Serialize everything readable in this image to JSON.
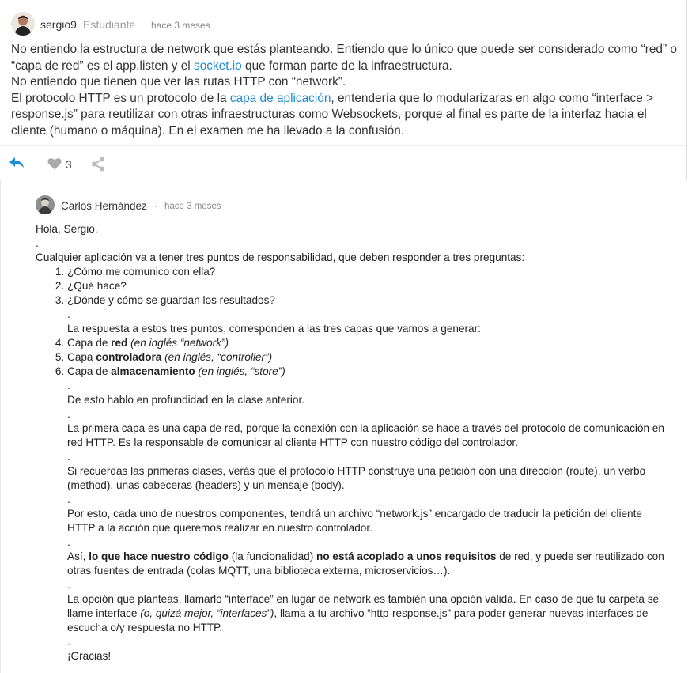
{
  "post": {
    "username": "sergio9",
    "role": "Estudiante",
    "separator": "·",
    "time": "hace 3 meses",
    "para1_a": "No entiendo la estructura de network que estás planteando. Entiendo que lo único que puede ser considerado como “red” o “capa de red” es el app.listen y el ",
    "para1_link": "socket.io",
    "para1_b": " que forman parte de la infraestructura.",
    "para2": "No entiendo que tienen que ver las rutas HTTP con “network”.",
    "para3_a": "El protocolo HTTP es un protocolo de la ",
    "para3_link": "capa de aplicación",
    "para3_b": ", entendería que lo modularizaras en algo como “interface > response.js” para reutilizar con otras infraestructuras como Websockets, porque al final es parte de la interfaz hacia el cliente (humano o máquina). En el examen me ha llevado a la confusión.",
    "likes": "3",
    "icons": {
      "reply": "reply-arrow-icon",
      "like": "heart-icon",
      "share": "share-icon"
    },
    "accent": "#1b8bd2"
  },
  "reply": {
    "username": "Carlos Hernández",
    "separator": "·",
    "time": "hace 3 meses",
    "greeting": "Hola, Sergio,",
    "dot": ".",
    "intro": "Cualquier aplicación va a tener tres puntos de responsabilidad, que deben responder a tres preguntas:",
    "questions": [
      "¿Cómo me comunico con ella?",
      "¿Qué hace?",
      "¿Dónde y cómo se guardan los resultados?"
    ],
    "answer_intro": "La respuesta a estos tres puntos, corresponden a las tres capas que vamos a generar:",
    "layers": [
      {
        "pre": "Capa de ",
        "bold": "red",
        "italic": " (en inglés “network”)"
      },
      {
        "pre": "Capa ",
        "bold": "controladora",
        "italic": " (en inglés, “controller”)"
      },
      {
        "pre": "Capa de ",
        "bold": "almacenamiento",
        "italic": " (en inglés, “store”)"
      }
    ],
    "p_depth": "De esto hablo en profundidad en la clase anterior.",
    "p_first": "La primera capa es una capa de red, porque la conexión con la aplicación se hace a través del protocolo de comunicación en red HTTP. Es la responsable de comunicar al cliente HTTP con nuestro código del controlador.",
    "p_recall": "Si recuerdas las primeras clases, verás que el protocolo HTTP construye una petición con una dirección (route), un verbo (method), unas cabeceras (headers) y un mensaje (body).",
    "p_each": "Por esto, cada uno de nuestros componentes, tendrá un archivo “network.js” encargado de traducir la petición del cliente HTTP a la acción que queremos realizar en nuestro controlador.",
    "p_asi_1": "Así, ",
    "p_asi_b1": "lo que hace nuestro código",
    "p_asi_2": " (la funcionalidad) ",
    "p_asi_b2": "no está acoplado a unos requisitos",
    "p_asi_3": " de red, y puede ser reutilizado con otras fuentes de entrada (colas MQTT, una biblioteca externa, microservicios…).",
    "p_opt_1": "La opción que planteas, llamarlo “interface” en lugar de network es también una opción válida. En caso de que tu carpeta se llame interface ",
    "p_opt_i": "(o, quizá mejor, “interfaces”)",
    "p_opt_2": ", llama a tu archivo “http-response.js” para poder generar nuevas interfaces de escucha o/y respuesta no HTTP.",
    "thanks": "¡Gracias!"
  }
}
